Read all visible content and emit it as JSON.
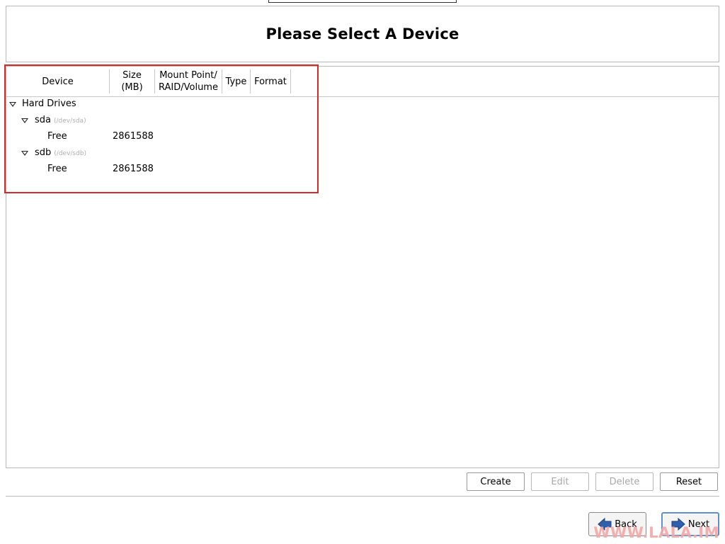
{
  "page": {
    "title": "Please Select A Device"
  },
  "table": {
    "columns": [
      {
        "line1": "Device",
        "line2": ""
      },
      {
        "line1": "Size",
        "line2": "(MB)"
      },
      {
        "line1": "Mount Point/",
        "line2": "RAID/Volume"
      },
      {
        "line1": "Type",
        "line2": ""
      },
      {
        "line1": "Format",
        "line2": ""
      }
    ],
    "group": {
      "label": "Hard Drives"
    },
    "disks": [
      {
        "name": "sda",
        "path": "(/dev/sda)",
        "partition": {
          "name": "Free",
          "size": "2861588"
        }
      },
      {
        "name": "sdb",
        "path": "(/dev/sdb)",
        "partition": {
          "name": "Free",
          "size": "2861588"
        }
      }
    ]
  },
  "actions": {
    "create": "Create",
    "edit": "Edit",
    "delete": "Delete",
    "reset": "Reset"
  },
  "nav": {
    "back": "Back",
    "next": "Next"
  },
  "watermark": "WWW.LALA.IM",
  "icons": {
    "back": "arrow-left-icon",
    "next": "arrow-right-icon",
    "expander": "triangle-down-icon"
  },
  "colors": {
    "highlight": "#d32a2a",
    "arrow_blue": "#2f5fae",
    "watermark": "#f3a7a7"
  }
}
